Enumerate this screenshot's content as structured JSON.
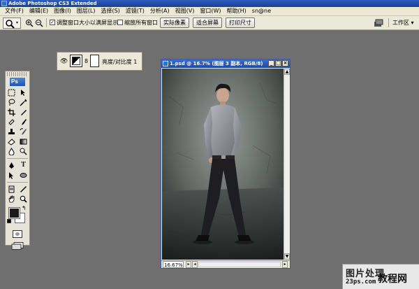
{
  "app": {
    "title": "Adobe Photoshop CS3 Extended"
  },
  "menu": [
    "文件(F)",
    "编辑(E)",
    "图像(I)",
    "图层(L)",
    "选择(S)",
    "滤镜(T)",
    "分析(A)",
    "视图(V)",
    "窗口(W)",
    "帮助(H)",
    "sn@ne"
  ],
  "options": {
    "resize_windows_label": "调整窗口大小以满屏显示",
    "resize_windows_checked": true,
    "zoom_all_label": "缩放所有窗口",
    "zoom_all_checked": false,
    "actual_pixels": "实际像素",
    "fit_screen": "适合屏幕",
    "print_size": "打印尺寸",
    "workspace": "工作区 ▾"
  },
  "toolbox": {
    "logo": "Ps",
    "tools": [
      "marquee-icon",
      "move-icon",
      "lasso-icon",
      "magic-wand-icon",
      "crop-icon",
      "slice-icon",
      "healing-brush-icon",
      "brush-icon",
      "clone-stamp-icon",
      "history-brush-icon",
      "eraser-icon",
      "gradient-icon",
      "blur-icon",
      "dodge-icon",
      "pen-icon",
      "type-icon",
      "path-selection-icon",
      "shape-icon",
      "notes-icon",
      "eyedropper-icon",
      "hand-icon",
      "zoom-icon"
    ],
    "foreground_color": "#1a1a1a",
    "background_color": "#ffffff"
  },
  "layer_panel": {
    "layer_name": "亮度/对比度 1"
  },
  "document": {
    "title": "1.psd @ 16.7% (图层 3 副本, RGB/8)",
    "zoom": "16.67%"
  },
  "watermark": {
    "line1": "图片处理",
    "line2": "23ps.com",
    "line3": "教程网"
  },
  "colors": {
    "workspace_bg": "#6f6f6f",
    "chrome_bg": "#ece9d8",
    "titlebar": "#2f5dbf"
  }
}
